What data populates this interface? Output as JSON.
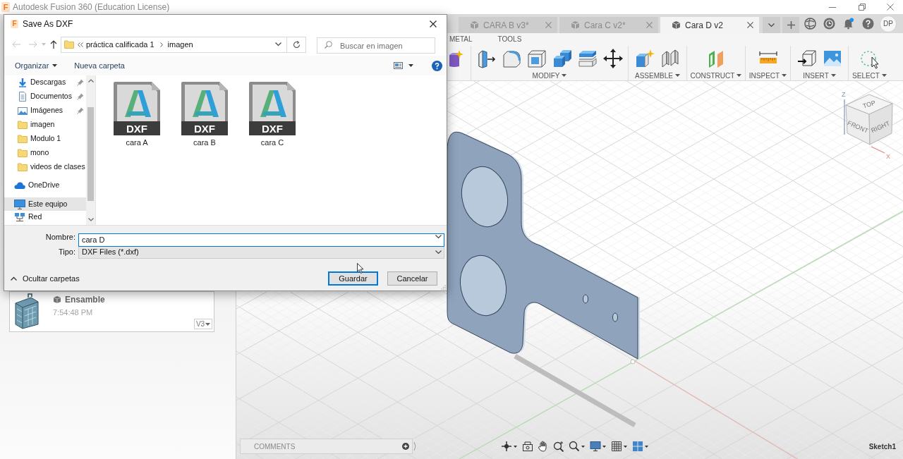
{
  "app_window": {
    "logo_letter": "F",
    "title": "Autodesk Fusion 360 (Education License)"
  },
  "document_tabs": [
    {
      "label": "CARA B v3*",
      "selected": false
    },
    {
      "label": "Cara C v2*",
      "selected": false
    },
    {
      "label": "Cara D v2",
      "selected": true
    }
  ],
  "user": {
    "initials": "DP"
  },
  "toolbar": {
    "tabs": [
      "METAL",
      "TOOLS"
    ],
    "groups": [
      {
        "label": "MODIFY"
      },
      {
        "label": "ASSEMBLE"
      },
      {
        "label": "CONSTRUCT"
      },
      {
        "label": "INSPECT"
      },
      {
        "label": "INSERT"
      },
      {
        "label": "SELECT"
      }
    ]
  },
  "data_panel": {
    "cards": [
      {
        "name": "Ensamble",
        "time": "7:54:48 PM",
        "version": "V3"
      }
    ]
  },
  "viewport": {
    "viewcube": {
      "faces": [
        "TOP",
        "FRONT",
        "RIGHT"
      ],
      "axes": [
        "Z",
        "X"
      ]
    }
  },
  "comments": {
    "label": "COMMENTS"
  },
  "status": {
    "active_sketch": "Sketch1"
  },
  "dialog": {
    "logo_letter": "F",
    "title": "Save As DXF",
    "path": [
      "práctica calificada 1",
      "imagen"
    ],
    "search": {
      "placeholder": "Buscar en imagen"
    },
    "commands": [
      {
        "label": "Organizar",
        "has_menu": true
      },
      {
        "label": "Nueva carpeta",
        "has_menu": false
      }
    ],
    "quick_access": [
      {
        "label": "Descargas",
        "kind": "downloads",
        "pinned": true,
        "selected": false
      },
      {
        "label": "Documentos",
        "kind": "documents",
        "pinned": true,
        "selected": false
      },
      {
        "label": "Imágenes",
        "kind": "pictures",
        "pinned": true,
        "selected": false
      },
      {
        "label": "imagen",
        "kind": "folder",
        "pinned": false,
        "selected": false
      },
      {
        "label": "Modulo 1",
        "kind": "folder",
        "pinned": false,
        "selected": false
      },
      {
        "label": "mono",
        "kind": "folder",
        "pinned": false,
        "selected": false
      },
      {
        "label": "videos de clases",
        "kind": "folder",
        "pinned": false,
        "selected": false
      }
    ],
    "locations": [
      {
        "label": "OneDrive",
        "kind": "onedrive",
        "selected": false
      },
      {
        "label": "Este equipo",
        "kind": "computer",
        "selected": true
      },
      {
        "label": "Red",
        "kind": "network",
        "selected": false
      }
    ],
    "files": [
      {
        "name": "cara A",
        "type": "DXF",
        "selected": false
      },
      {
        "name": "cara B",
        "type": "DXF",
        "selected": false
      },
      {
        "name": "cara C",
        "type": "DXF",
        "selected": false
      }
    ],
    "name_field": {
      "label": "Nombre:",
      "value": "cara D"
    },
    "type_field": {
      "label": "Tipo:",
      "value": "DXF Files (*.dxf)"
    },
    "folders_toggle": {
      "label": "Ocultar carpetas",
      "expanded": true
    },
    "buttons": [
      {
        "label": "Guardar",
        "default": true
      },
      {
        "label": "Cancelar",
        "default": false
      }
    ]
  }
}
